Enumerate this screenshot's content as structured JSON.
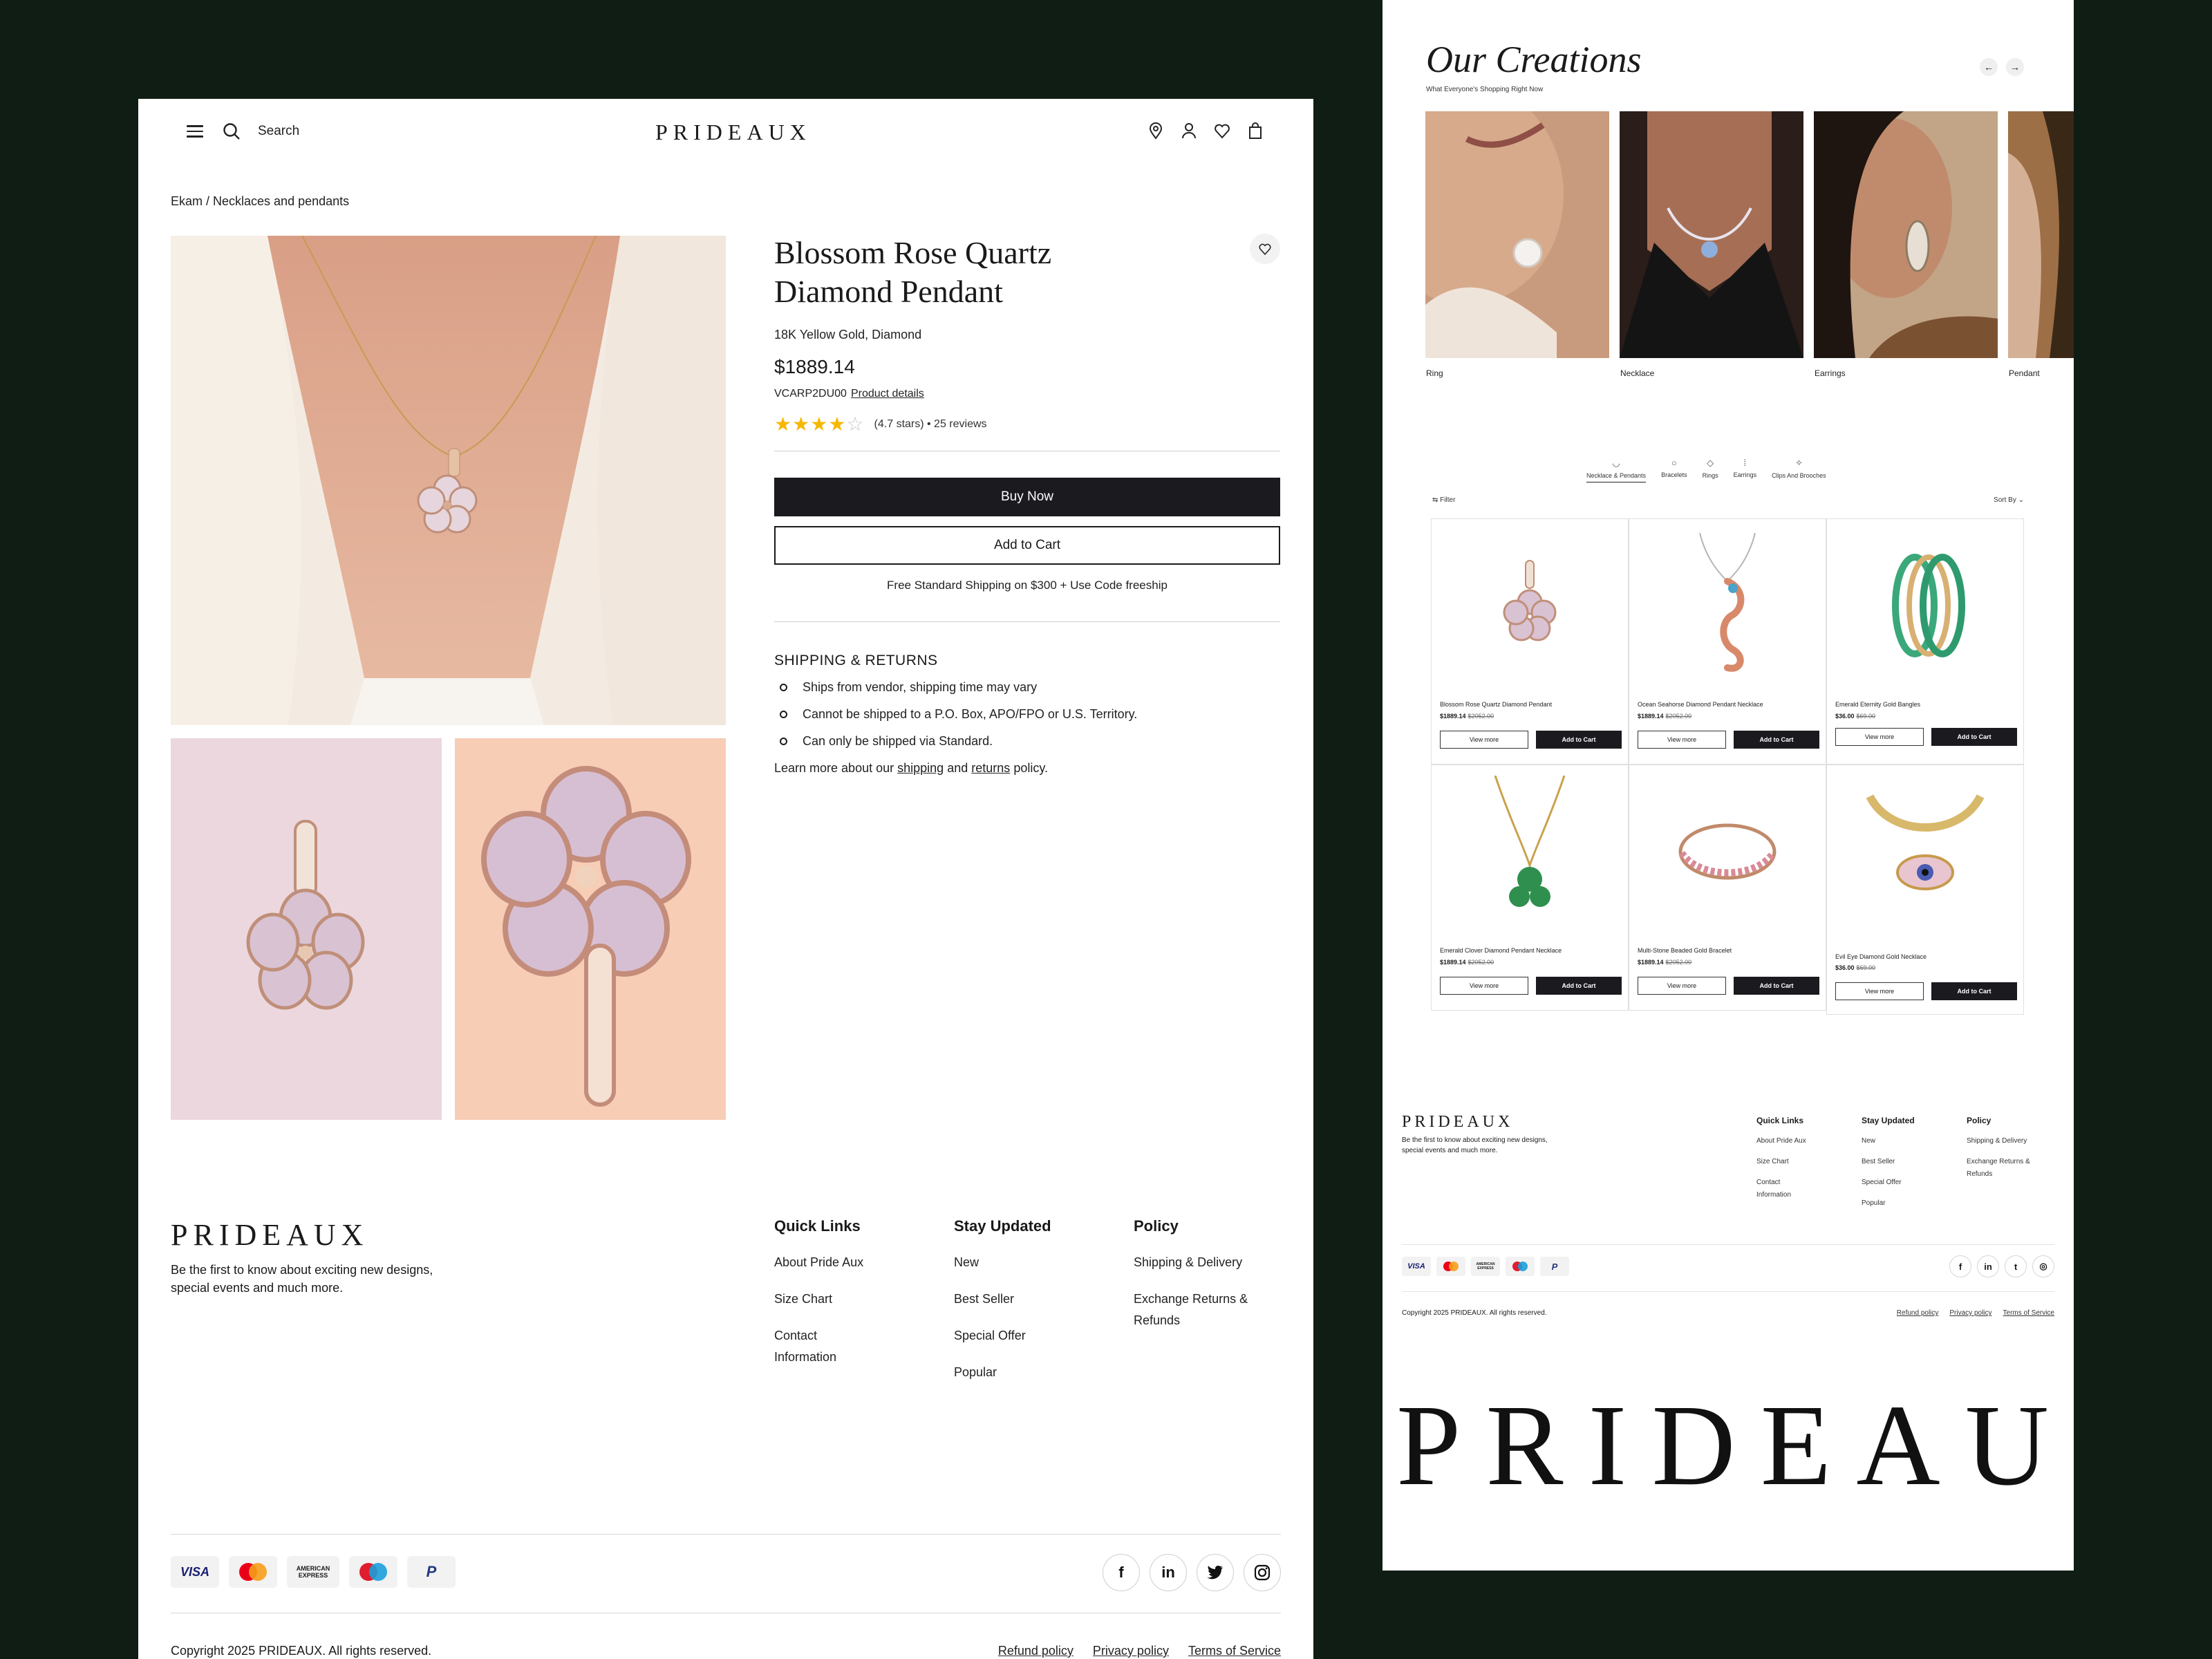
{
  "colors": {
    "background": "#0f1d14",
    "panel": "#ffffff",
    "accent": "#1a1a1f",
    "star": "#f5b800"
  },
  "product_page": {
    "nav": {
      "search_label": "Search",
      "logo": "PRIDEAUX",
      "icons": [
        "location-icon",
        "user-icon",
        "heart-icon",
        "bag-icon"
      ]
    },
    "breadcrumb": "Ekam / Necklaces and pendants",
    "product": {
      "title_line1": "Blossom Rose Quartz",
      "title_line2": "Diamond Pendant",
      "material": "18K Yellow Gold, Diamond",
      "price": "$1889.14",
      "sku": "VCARP2DU00",
      "details_link": "Product details",
      "rating": 4.7,
      "rating_text": "(4.7 stars) • 25 reviews",
      "buy_now": "Buy Now",
      "add_to_cart": "Add to Cart",
      "shipping_note": "Free Standard Shipping on $300 + Use Code freeship"
    },
    "shipping_returns": {
      "title": "SHIPPING & RETURNS",
      "items": [
        "Ships from vendor, shipping time may vary",
        "Cannot be shipped to a P.O. Box, APO/FPO or U.S. Territory.",
        "Can only be shipped via Standard."
      ],
      "learn_prefix": "Learn more about our",
      "learn_shipping": "shipping",
      "learn_and": "and",
      "learn_returns": "returns",
      "learn_suffix": "policy."
    },
    "footer": {
      "logo": "PRIDEAUX",
      "tagline_line1": "Be the first to know about exciting new designs,",
      "tagline_line2": "special events and much more.",
      "columns": [
        {
          "title": "Quick Links",
          "links": [
            "About Pride Aux",
            "Size Chart",
            "Contact Information"
          ]
        },
        {
          "title": "Stay Updated",
          "links": [
            "New",
            "Best Seller",
            "Special Offer",
            "Popular"
          ]
        },
        {
          "title": "Policy",
          "links": [
            "Shipping & Delivery",
            "Exchange Returns & Refunds"
          ]
        }
      ],
      "payments": [
        "VISA",
        "Mastercard",
        "AMERICAN EXPRESS",
        "Maestro",
        "PayPal"
      ],
      "socials": [
        "f",
        "in",
        "t",
        "ig"
      ],
      "copyright": "Copyright 2025 PRIDEAUX. All rights reserved.",
      "legal": [
        "Refund policy",
        "Privacy policy",
        "Terms of Service"
      ]
    }
  },
  "creations_page": {
    "title": "Our Creations",
    "subtitle": "What Everyone's Shopping Right Now",
    "categories": [
      "Ring",
      "Necklace",
      "Earrings",
      "Pendant"
    ],
    "tabs": [
      "Necklace & Pendants",
      "Bracelets",
      "Rings",
      "Earrings",
      "Clips And Brooches"
    ],
    "filter_label": "Filter",
    "sort_label": "Sort By",
    "products": [
      {
        "name": "Blossom Rose Quartz Diamond Pendant",
        "price": "$1889.14",
        "old": "$2052.00"
      },
      {
        "name": "Ocean Seahorse Diamond Pendant Necklace",
        "price": "$1889.14",
        "old": "$2052.00"
      },
      {
        "name": "Emerald Eternity Gold Bangles",
        "price": "$36.00",
        "old": "$69.00"
      },
      {
        "name": "Emerald Clover Diamond Pendant Necklace",
        "price": "$1889.14",
        "old": "$2052.00"
      },
      {
        "name": "Multi-Stone Beaded Gold Bracelet",
        "price": "$1889.14",
        "old": "$2052.00"
      },
      {
        "name": "Evil Eye Diamond Gold Necklace",
        "price": "$36.00",
        "old": "$69.00"
      }
    ],
    "view_more": "View more",
    "add_to_cart": "Add to Cart",
    "footer": {
      "logo": "PRIDEAUX",
      "tagline_line1": "Be the first to know about exciting new designs,",
      "tagline_line2": "special events and much more.",
      "copyright": "Copyright 2025 PRIDEAUX. All rights reserved.",
      "legal": [
        "Refund policy",
        "Privacy policy",
        "Terms of Service"
      ]
    },
    "big_logo": "PRIDEAUX"
  }
}
